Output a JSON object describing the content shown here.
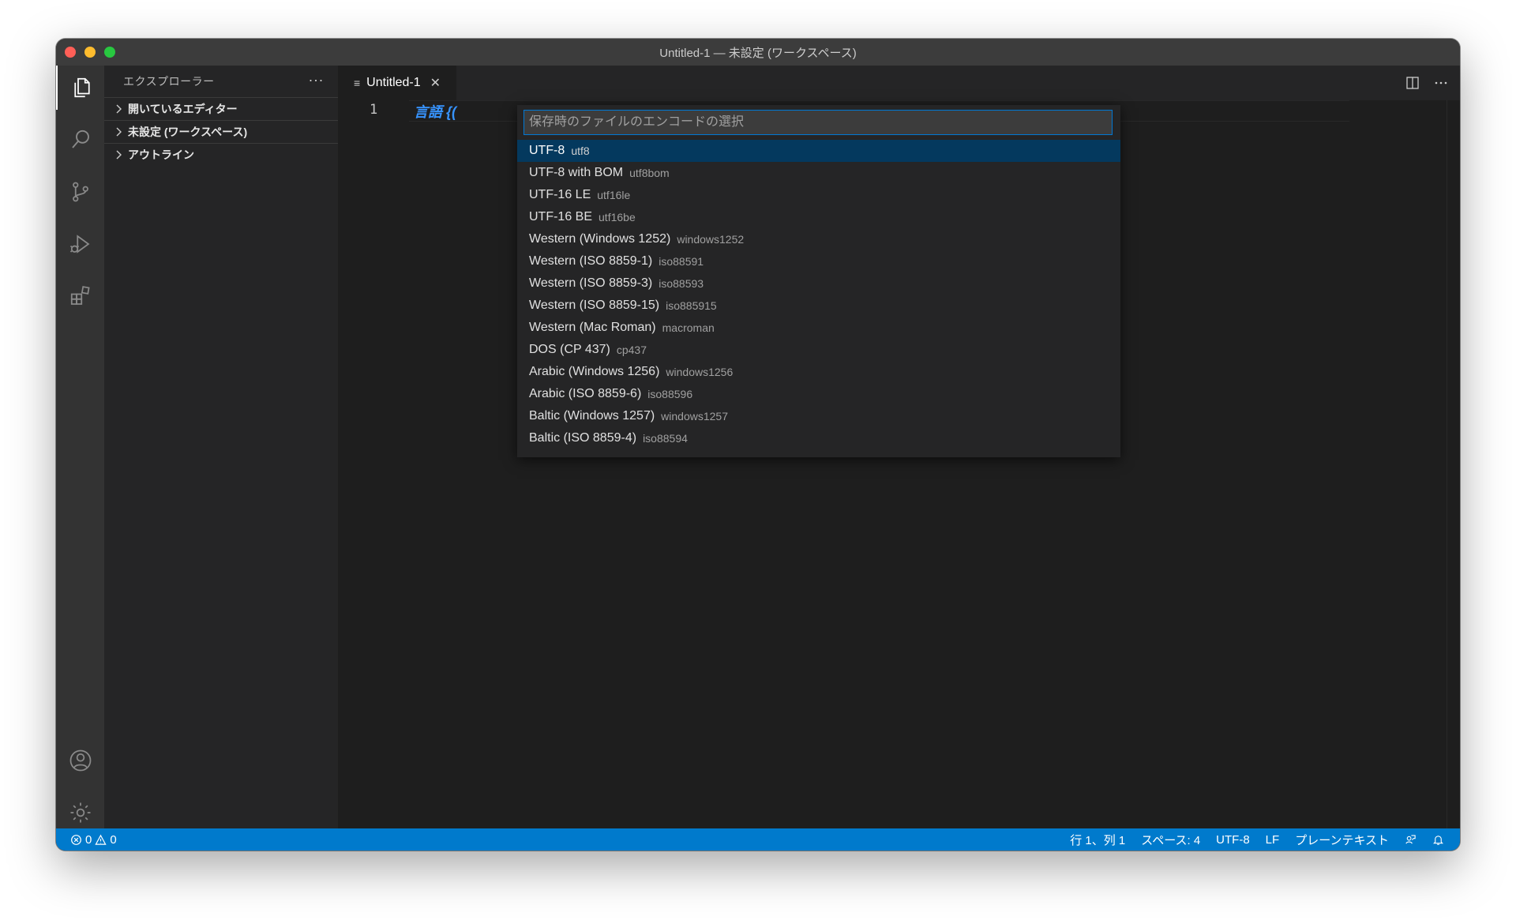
{
  "window": {
    "title": "Untitled-1 — 未設定 (ワークスペース)"
  },
  "activity_bar": {
    "items": [
      "explorer-icon",
      "search-icon",
      "source-control-icon",
      "run-debug-icon",
      "extensions-icon"
    ],
    "bottom": [
      "account-icon",
      "settings-gear-icon"
    ]
  },
  "sidebar": {
    "title": "エクスプローラー",
    "more": "···",
    "sections": [
      {
        "label": "開いているエディター"
      },
      {
        "label": "未設定 (ワークスペース)"
      },
      {
        "label": "アウトライン"
      }
    ]
  },
  "editor": {
    "tab_label": "Untitled-1",
    "line_number": "1",
    "code_visible": "言語 {("
  },
  "quick_pick": {
    "placeholder": "保存時のファイルのエンコードの選択",
    "items": [
      {
        "label": "UTF-8",
        "desc": "utf8"
      },
      {
        "label": "UTF-8 with BOM",
        "desc": "utf8bom"
      },
      {
        "label": "UTF-16 LE",
        "desc": "utf16le"
      },
      {
        "label": "UTF-16 BE",
        "desc": "utf16be"
      },
      {
        "label": "Western (Windows 1252)",
        "desc": "windows1252"
      },
      {
        "label": "Western (ISO 8859-1)",
        "desc": "iso88591"
      },
      {
        "label": "Western (ISO 8859-3)",
        "desc": "iso88593"
      },
      {
        "label": "Western (ISO 8859-15)",
        "desc": "iso885915"
      },
      {
        "label": "Western (Mac Roman)",
        "desc": "macroman"
      },
      {
        "label": "DOS (CP 437)",
        "desc": "cp437"
      },
      {
        "label": "Arabic (Windows 1256)",
        "desc": "windows1256"
      },
      {
        "label": "Arabic (ISO 8859-6)",
        "desc": "iso88596"
      },
      {
        "label": "Baltic (Windows 1257)",
        "desc": "windows1257"
      },
      {
        "label": "Baltic (ISO 8859-4)",
        "desc": "iso88594"
      }
    ]
  },
  "status_bar": {
    "errors": "0",
    "warnings": "0",
    "position": "行 1、列 1",
    "indent": "スペース: 4",
    "encoding": "UTF-8",
    "eol": "LF",
    "language": "プレーンテキスト"
  },
  "colors": {
    "accent": "#007acc",
    "selected_item": "#04395e",
    "focus_border": "#0078d4"
  }
}
